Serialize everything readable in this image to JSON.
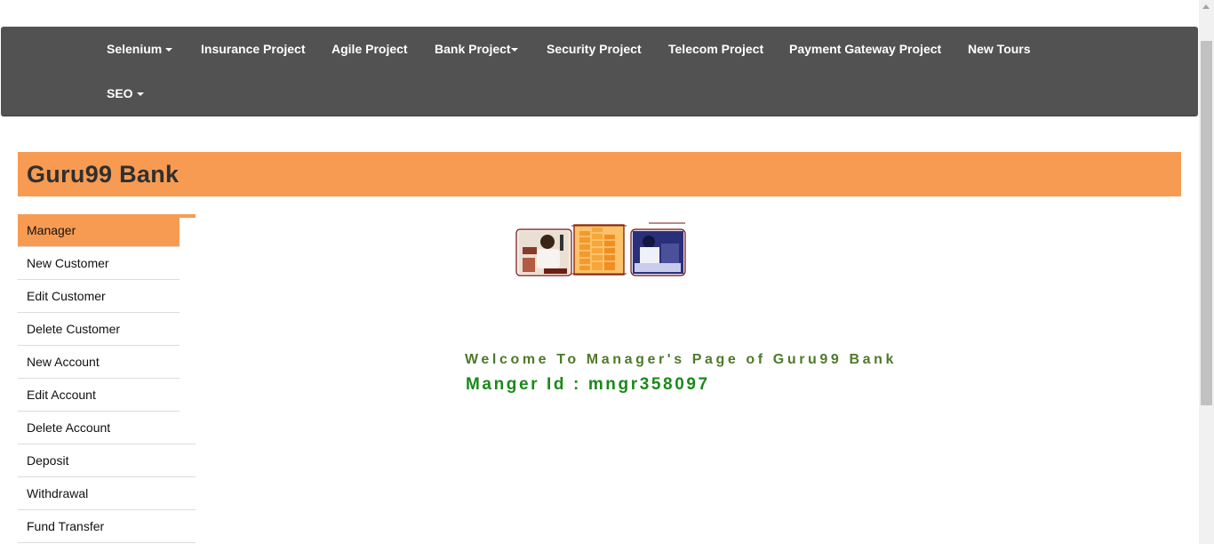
{
  "nav": {
    "selenium": "Selenium",
    "insurance": "Insurance Project",
    "agile": "Agile Project",
    "bank": "Bank Project",
    "security": "Security Project",
    "telecom": "Telecom Project",
    "payment": "Payment Gateway Project",
    "new_tours": "New Tours",
    "seo": "SEO"
  },
  "banner": {
    "title": "Guru99 Bank"
  },
  "sidebar": {
    "items": [
      {
        "label": "Manager"
      },
      {
        "label": "New Customer"
      },
      {
        "label": "Edit Customer"
      },
      {
        "label": "Delete Customer"
      },
      {
        "label": "New Account"
      },
      {
        "label": "Edit Account"
      },
      {
        "label": "Delete Account"
      },
      {
        "label": "Deposit"
      },
      {
        "label": "Withdrawal"
      },
      {
        "label": "Fund Transfer"
      }
    ]
  },
  "main": {
    "welcome": "Welcome To Manager's Page of Guru99 Bank",
    "manager_id": "Manger Id : mngr358097"
  },
  "colors": {
    "navbar_bg": "#525252",
    "accent_orange": "#f79b52",
    "welcome_green": "#4e7a2a",
    "manager_id_green": "#1a8a1a"
  }
}
